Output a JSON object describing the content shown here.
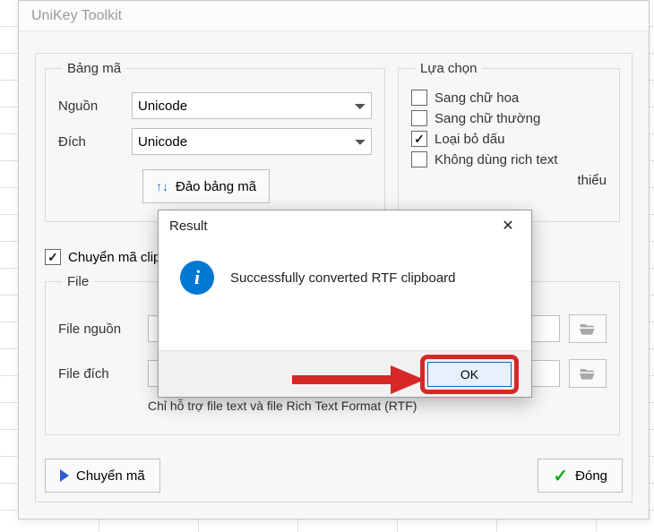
{
  "window": {
    "title": "UniKey Toolkit"
  },
  "bangma": {
    "legend": "Bảng mã",
    "source_label": "Nguồn",
    "dest_label": "Đích",
    "source_value": "Unicode",
    "dest_value": "Unicode",
    "swap_label": "Đảo bảng mã"
  },
  "luachon": {
    "legend": "Lựa chọn",
    "items": [
      {
        "label": "Sang chữ hoa",
        "checked": false
      },
      {
        "label": "Sang chữ thường",
        "checked": false
      },
      {
        "label": "Loại bỏ dấu",
        "checked": true
      },
      {
        "label": "Không dùng rich text",
        "checked": false
      },
      {
        "label": "thiểu",
        "checked": false
      }
    ]
  },
  "clipboard": {
    "label": "Chuyển mã clip",
    "checked": true
  },
  "file": {
    "legend": "File",
    "source_label": "File nguồn",
    "dest_label": "File đích",
    "source_value": "",
    "dest_value": "",
    "hint": "Chỉ hỗ trợ file text và file Rich Text Format (RTF)"
  },
  "buttons": {
    "convert": "Chuyển mã",
    "close": "Đóng"
  },
  "modal": {
    "title": "Result",
    "message": "Successfully converted RTF clipboard",
    "ok": "OK"
  }
}
